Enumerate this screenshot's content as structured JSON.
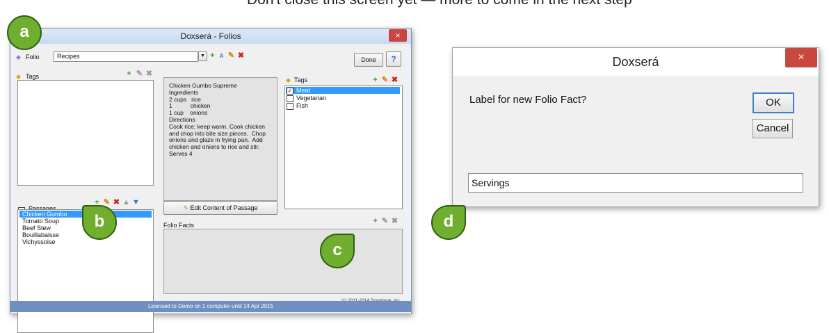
{
  "caption": "Don't close this screen yet — more to come in the next step",
  "window": {
    "title": "Doxserá - Folios",
    "close": "×",
    "folio_label": "Folio",
    "folio_value": "Recipes",
    "done_label": "Done",
    "help_label": "?",
    "tags_left_label": "Tags",
    "passages_label": "Passages",
    "passages": [
      "Chicken Gumbo",
      "Tomato Soup",
      "Beef Stew",
      "Bouillabaisse",
      "Vichyssoise"
    ],
    "passage_text": "Chicken Gumbo Supreme\nIngredients\n2 cups   rice\n1           chicken\n1 cup    onions\nDirections\nCook rice; keep warm. Cook chicken and chop into bite size pieces.  Chop onions and glaze in frying pan.  Add chicken and onions to rice and stir.\nServes 4",
    "edit_content_label": "Edit Content of Passage",
    "tags_right_label": "Tags",
    "tags": [
      {
        "label": "Meat",
        "checked": true
      },
      {
        "label": "Vegetarian",
        "checked": false
      },
      {
        "label": "Fish",
        "checked": false
      }
    ],
    "folio_facts_label": "Folio Facts",
    "copyright": "(c) 2011-2014 Snapdone, Inc.",
    "status": "Licensed to Demo on 1 computer until 14 Apr 2015"
  },
  "dialog": {
    "title": "Doxserá",
    "close": "×",
    "prompt": "Label for new Folio Fact?",
    "ok_label": "OK",
    "cancel_label": "Cancel",
    "input_value": "Servings"
  },
  "callouts": {
    "a": "a",
    "b": "b",
    "c": "c",
    "d": "d"
  },
  "colors": {
    "accent": "#3399ff",
    "callout": "#6fae2e",
    "close": "#c9473f",
    "status": "#6e8fbf"
  }
}
